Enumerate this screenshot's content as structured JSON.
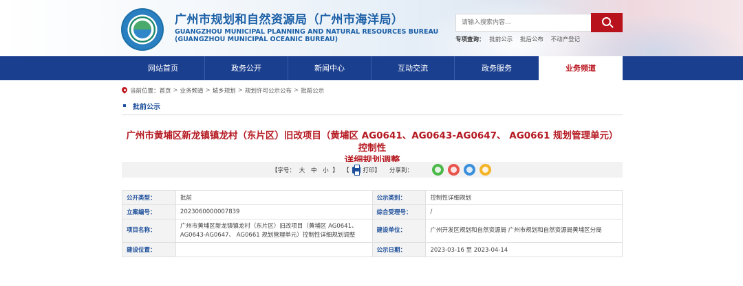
{
  "header": {
    "title_cn": "广州市规划和自然资源局（广州市海洋局）",
    "title_en_1": "GUANGZHOU MUNICIPAL PLANNING AND NATURAL RESOURCES BUREAU",
    "title_en_2": "(GUANGZHOU MUNICIPAL OCEANIC BUREAU)",
    "search_placeholder": "请输入搜索内容...",
    "hot_label": "专项查询：",
    "hot_keywords": [
      "批前公示",
      "批后公布",
      "不动产登记"
    ]
  },
  "nav": {
    "items": [
      {
        "label": "网站首页"
      },
      {
        "label": "政务公开"
      },
      {
        "label": "新闻中心"
      },
      {
        "label": "互动交流"
      },
      {
        "label": "政务服务"
      },
      {
        "label": "业务频道"
      }
    ],
    "active_index": 5
  },
  "breadcrumb": {
    "prefix": "当前位置：",
    "items": [
      "首页",
      "业务频道",
      "城乡规划",
      "规划许可公示公布",
      "批前公示"
    ],
    "separator": ">"
  },
  "section": {
    "title": "批前公示"
  },
  "article": {
    "title_line1": "广州市黄埔区新龙镇镇龙村（东片区）旧改项目（黄埔区 AG0641、AG0643-AG0647、 AG0661 规划管理单元）控制性",
    "title_line2": "详细规划调整"
  },
  "toolbar": {
    "fontsize_open": "【字号：",
    "fontsize_big": "大",
    "fontsize_mid": "中",
    "fontsize_small": "小",
    "fontsize_close": "】",
    "print_open": "【",
    "print_label": "打印",
    "print_close": "】",
    "share_label": "分享到："
  },
  "info": {
    "rows": [
      {
        "k1": "公开类型：",
        "v1": "批前",
        "k2": "公示类别：",
        "v2": "控制性详细规划"
      },
      {
        "k1": "立案编号：",
        "v1": "2023060000007839",
        "k2": "综合受理号：",
        "v2": "/"
      },
      {
        "k1": "项目名称：",
        "v1_line1": "广州市黄埔区新龙镇镇龙村（东片区）旧改项目（黄埔区 AG0641、",
        "v1_line2": "AG0643-AG0647、 AG0661 规划管理单元）控制性详细规划调整",
        "k2": "建设单位：",
        "v2": "广州开发区规划和自然资源局 广州市规划和自然资源局黄埔区分局"
      },
      {
        "k1": "建设位置：",
        "v1": "",
        "k2": "公示日期：",
        "v2": "2023-03-16 至 2023-04-14"
      }
    ]
  }
}
